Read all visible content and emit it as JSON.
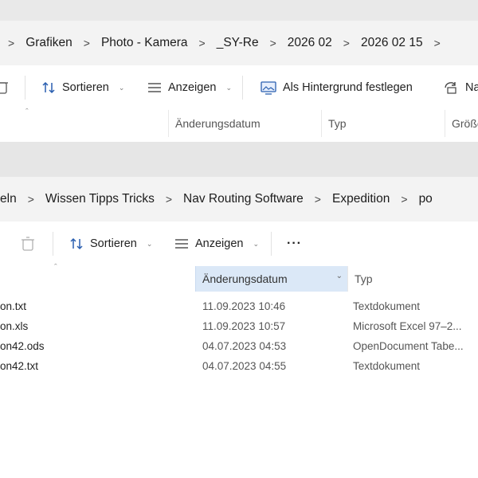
{
  "window1": {
    "breadcrumb": [
      "Grafiken",
      "Photo - Kamera",
      "_SY-Re",
      "2026 02",
      "2026 02 15"
    ],
    "toolbar": {
      "sort_label": "Sortieren",
      "view_label": "Anzeigen",
      "set_background_label": "Als Hintergrund festlegen",
      "next_label": "Na"
    },
    "columns": {
      "date": "Änderungsdatum",
      "type": "Typ",
      "size": "Größe"
    }
  },
  "window2": {
    "breadcrumb": [
      "eln",
      "Wissen Tipps Tricks",
      "Nav Routing Software",
      "Expedition",
      "po"
    ],
    "toolbar": {
      "sort_label": "Sortieren",
      "view_label": "Anzeigen",
      "more_label": "···"
    },
    "columns": {
      "date": "Änderungsdatum",
      "type": "Typ"
    },
    "files": [
      {
        "name": "on.txt",
        "date": "11.09.2023 10:46",
        "type": "Textdokument"
      },
      {
        "name": "on.xls",
        "date": "11.09.2023 10:57",
        "type": "Microsoft Excel 97–2..."
      },
      {
        "name": "on42.ods",
        "date": "04.07.2023 04:53",
        "type": "OpenDocument Tabe..."
      },
      {
        "name": "on42.txt",
        "date": "04.07.2023 04:55",
        "type": "Textdokument"
      }
    ]
  }
}
